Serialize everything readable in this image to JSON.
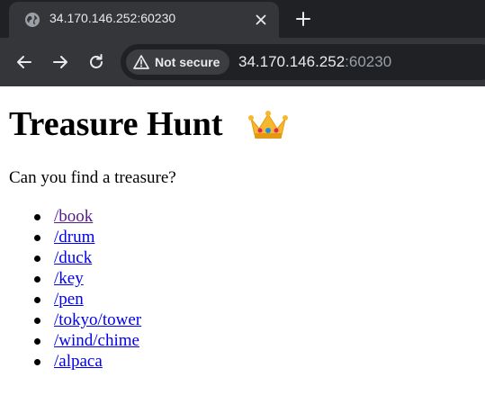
{
  "browser": {
    "tab": {
      "title": "34.170.146.252:60230"
    },
    "address": {
      "security_label": "Not secure",
      "host": "34.170.146.252",
      "port": ":60230"
    }
  },
  "page": {
    "title": "Treasure Hunt",
    "title_emoji": "crown-icon",
    "intro": "Can you find a treasure?",
    "links": [
      {
        "label": "/book",
        "visited": true
      },
      {
        "label": "/drum",
        "visited": false
      },
      {
        "label": "/duck",
        "visited": false
      },
      {
        "label": "/key",
        "visited": false
      },
      {
        "label": "/pen",
        "visited": false
      },
      {
        "label": "/tokyo/tower",
        "visited": false
      },
      {
        "label": "/wind/chime",
        "visited": false
      },
      {
        "label": "/alpaca",
        "visited": false
      }
    ]
  },
  "colors": {
    "link": "#0000ee",
    "visited_link": "#551a8b",
    "chrome_dark": "#202124",
    "chrome_mid": "#35363a"
  }
}
